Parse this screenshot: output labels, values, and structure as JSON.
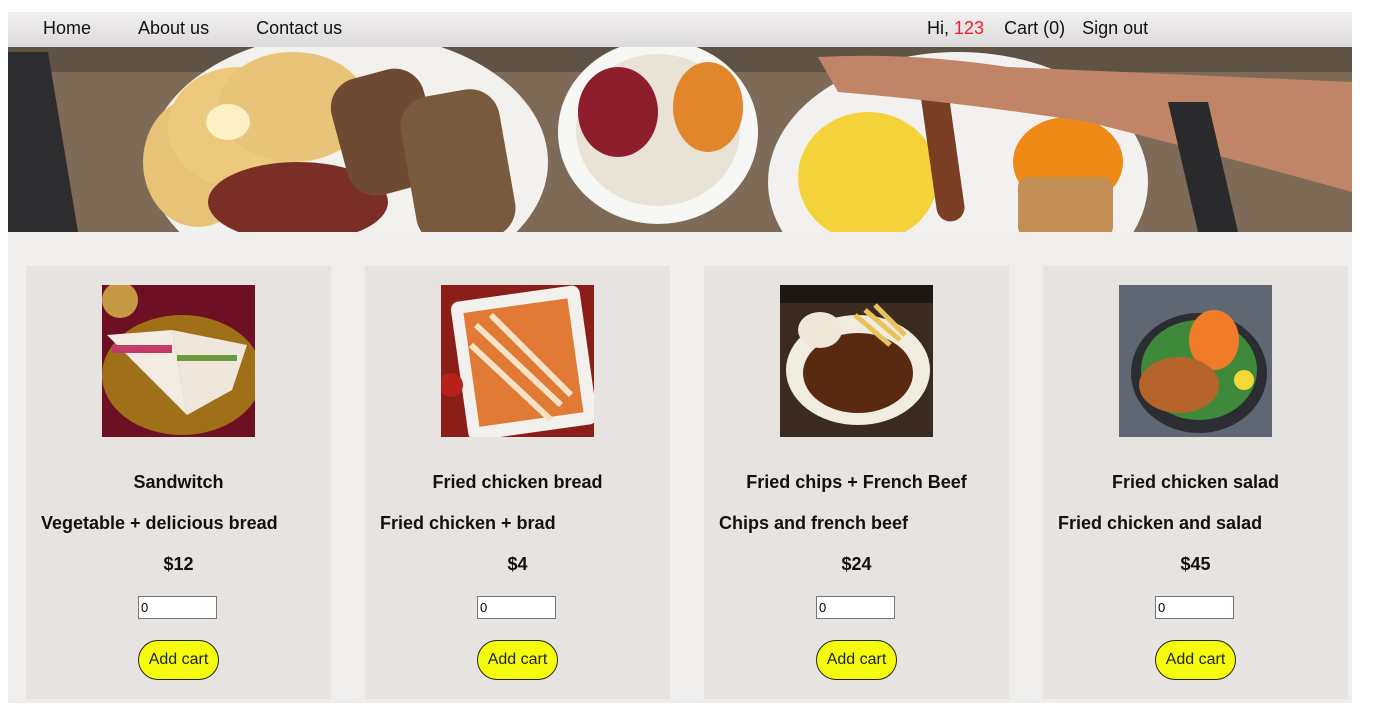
{
  "nav": {
    "home": "Home",
    "about": "About us",
    "contact": "Contact us",
    "greeting": "Hi,",
    "username": "123",
    "cart": "Cart (0)",
    "signout": "Sign out"
  },
  "products": [
    {
      "name": "Sandwitch",
      "desc": "Vegetable + delicious bread",
      "price": "$12",
      "qty": "0",
      "button": "Add cart"
    },
    {
      "name": "Fried chicken bread",
      "desc": "Fried chicken + brad",
      "price": "$4",
      "qty": "0",
      "button": "Add cart"
    },
    {
      "name": "Fried chips + French Beef",
      "desc": "Chips and french beef",
      "price": "$24",
      "qty": "0",
      "button": "Add cart"
    },
    {
      "name": "Fried chicken salad",
      "desc": "Fried chicken and salad",
      "price": "$45",
      "qty": "0",
      "button": "Add cart"
    }
  ],
  "colors": {
    "accent_button": "#f4fb0c",
    "username": "#e8202a",
    "card": "#e7e3e0"
  }
}
